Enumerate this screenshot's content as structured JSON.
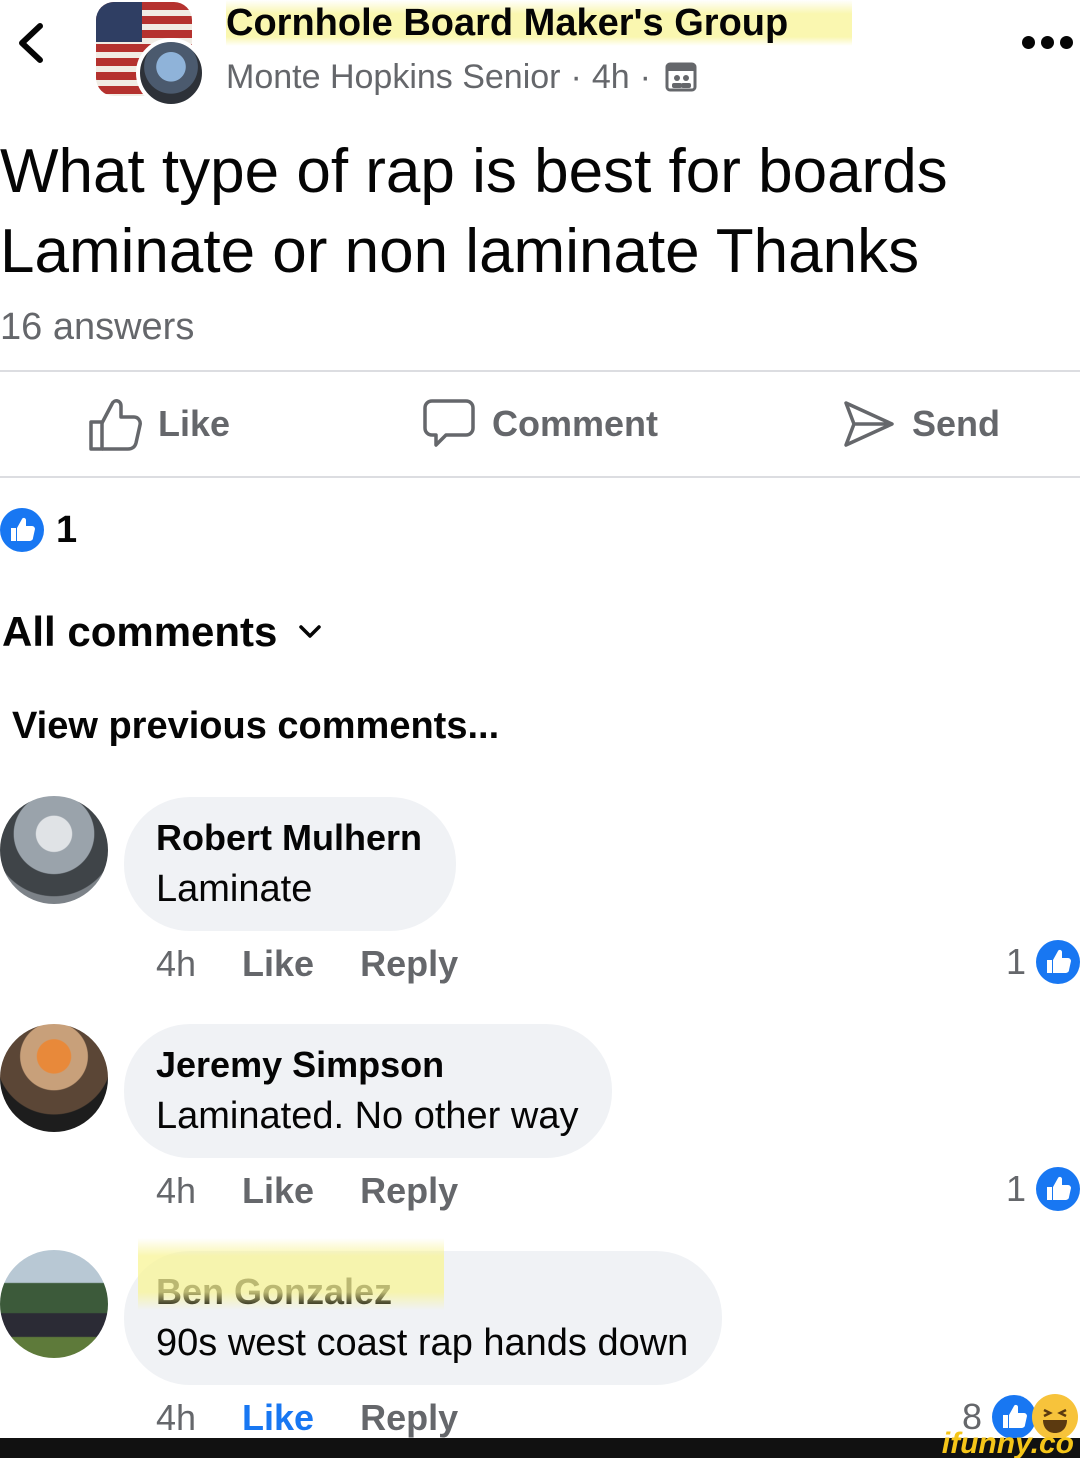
{
  "header": {
    "group_name": "Cornhole Board Maker's Group",
    "author": "Monte Hopkins Senior",
    "separator": "·",
    "time": "4h"
  },
  "post": {
    "text": "What type of  rap is best for boards Laminate or non laminate Thanks",
    "answers": "16 answers"
  },
  "actions": {
    "like": "Like",
    "comment": "Comment",
    "send": "Send"
  },
  "reactions": {
    "count": "1"
  },
  "comments_section": {
    "filter_label": "All comments",
    "view_previous": "View previous comments..."
  },
  "comments": [
    {
      "author": "Robert Mulhern",
      "text": "Laminate",
      "time": "4h",
      "like": "Like",
      "reply": "Reply",
      "reaction_count": "1",
      "liked": false
    },
    {
      "author": "Jeremy Simpson",
      "text": "Laminated.  No other way",
      "time": "4h",
      "like": "Like",
      "reply": "Reply",
      "reaction_count": "1",
      "liked": false
    },
    {
      "author": "Ben Gonzalez",
      "text": "90s west coast rap hands down",
      "time": "4h",
      "like": "Like",
      "reply": "Reply",
      "reaction_count": "8",
      "liked": true
    }
  ],
  "watermark": "ifunny.co",
  "colors": {
    "accent": "#1877f2",
    "secondary_text": "#65676b",
    "bubble": "#f0f2f5",
    "highlight": "#f8f496"
  },
  "icons": [
    "back-icon",
    "more-icon",
    "group-icon",
    "like-icon",
    "comment-icon",
    "send-icon",
    "like-reaction-icon",
    "chevron-down-icon",
    "haha-reaction-icon"
  ]
}
